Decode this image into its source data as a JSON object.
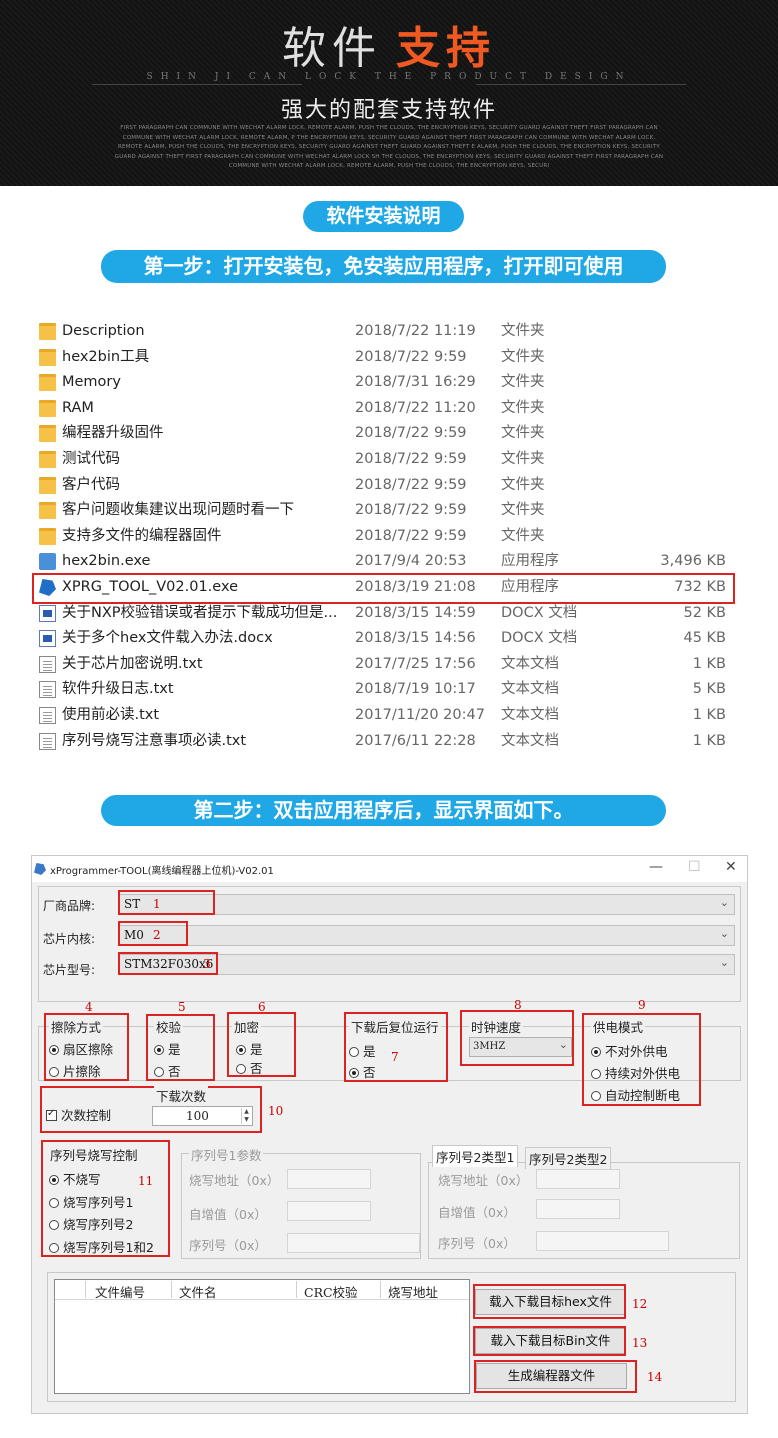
{
  "banner": {
    "title_a": "软件",
    "title_b": "支持",
    "subtitle": "SHIN JI CAN LOCK THE PRODUCT DESIGN",
    "tagline": "强大的配套支持软件",
    "fine_print": "FIRST PARAGRAPH CAN COMMUNE WITH WECHAT ALARM LOCK, REMOTE ALARM, PUSH THE CLOUDS, THE ENCRYPTION KEYS, SECURITY GUARD AGAINST THEFT FIRST PARAGRAPH CAN COMMUNE WITH WECHAT ALARM LOCK, REMOTE ALARM, P THE ENCRYPTION KEYS, SECURITY GUARD AGAINST THEFT FIRST PARAGRAPH CAN COMMUNE WITH WECHAT ALARM LOCK, REMOTE ALARM, PUSH THE CLOUDS, THE ENCRYPTION KEYS, SECURITY GUARD AGAINST THEFT GUARD AGAINST THEFT E ALARM, PUSH THE CLOUDS, THE ENCRYPTION KEYS, SECURITY GUARD AGAINST THEFT FIRST PARAGRAPH CAN COMMUNE WITH WECHAT ALARM LOCK SH THE CLOUDS, THE ENCRYPTION KEYS, SECURITY GUARD AGAINST THEFT FIRST PARAGRAPH CAN COMMUNE WITH WECHAT ALARM LOCK, REMOTE ALARM, PUSH THE CLOUDS, THE ENCRYPTION KEYS, SECURI"
  },
  "pills": {
    "install": "软件安装说明",
    "step1": "第一步：打开安装包，免安装应用程序，打开即可使用",
    "step2": "第二步：双击应用程序后，显示界面如下。"
  },
  "files": [
    {
      "name": "Description",
      "date": "2018/7/22 11:19",
      "type": "文件夹",
      "size": "",
      "icon": "folder"
    },
    {
      "name": "hex2bin工具",
      "date": "2018/7/22 9:59",
      "type": "文件夹",
      "size": "",
      "icon": "folder"
    },
    {
      "name": "Memory",
      "date": "2018/7/31 16:29",
      "type": "文件夹",
      "size": "",
      "icon": "folder"
    },
    {
      "name": "RAM",
      "date": "2018/7/22 11:20",
      "type": "文件夹",
      "size": "",
      "icon": "folder"
    },
    {
      "name": "编程器升级固件",
      "date": "2018/7/22 9:59",
      "type": "文件夹",
      "size": "",
      "icon": "folder"
    },
    {
      "name": "测试代码",
      "date": "2018/7/22 9:59",
      "type": "文件夹",
      "size": "",
      "icon": "folder"
    },
    {
      "name": "客户代码",
      "date": "2018/7/22 9:59",
      "type": "文件夹",
      "size": "",
      "icon": "folder"
    },
    {
      "name": "客户问题收集建议出现问题时看一下",
      "date": "2018/7/22 9:59",
      "type": "文件夹",
      "size": "",
      "icon": "folder"
    },
    {
      "name": "支持多文件的编程器固件",
      "date": "2018/7/22 9:59",
      "type": "文件夹",
      "size": "",
      "icon": "folder"
    },
    {
      "name": "hex2bin.exe",
      "date": "2017/9/4 20:53",
      "type": "应用程序",
      "size": "3,496 KB",
      "icon": "exe"
    },
    {
      "name": "XPRG_TOOL_V02.01.exe",
      "date": "2018/3/19 21:08",
      "type": "应用程序",
      "size": "732 KB",
      "icon": "exe2"
    },
    {
      "name": "关于NXP校验错误或者提示下载成功但是...",
      "date": "2018/3/15 14:59",
      "type": "DOCX 文档",
      "size": "52 KB",
      "icon": "doc"
    },
    {
      "name": "关于多个hex文件载入办法.docx",
      "date": "2018/3/15 14:56",
      "type": "DOCX 文档",
      "size": "45 KB",
      "icon": "doc"
    },
    {
      "name": "关于芯片加密说明.txt",
      "date": "2017/7/25 17:56",
      "type": "文本文档",
      "size": "1 KB",
      "icon": "txt"
    },
    {
      "name": "软件升级日志.txt",
      "date": "2018/7/19 10:17",
      "type": "文本文档",
      "size": "5 KB",
      "icon": "txt"
    },
    {
      "name": "使用前必读.txt",
      "date": "2017/11/20 20:47",
      "type": "文本文档",
      "size": "1 KB",
      "icon": "txt"
    },
    {
      "name": "序列号烧写注意事项必读.txt",
      "date": "2017/6/11 22:28",
      "type": "文本文档",
      "size": "1 KB",
      "icon": "txt"
    }
  ],
  "app": {
    "title": "xProgrammer-TOOL(离线编程器上位机)-V02.01",
    "btn_min": "—",
    "btn_max": "☐",
    "btn_close": "✕",
    "vendor_label": "厂商品牌:",
    "vendor_value": "ST",
    "core_label": "芯片内核:",
    "core_value": "M0",
    "model_label": "芯片型号:",
    "model_value": "STM32F030x6",
    "erase": {
      "title": "擦除方式",
      "opt1": "扇区擦除",
      "opt2": "片擦除"
    },
    "verify": {
      "title": "校验",
      "opt1": "是",
      "opt2": "否"
    },
    "encrypt": {
      "title": "加密",
      "opt1": "是",
      "opt2": "否"
    },
    "reset": {
      "title": "下载后复位运行",
      "opt1": "是",
      "opt2": "否"
    },
    "clock": {
      "title": "时钟速度",
      "value": "3MHZ"
    },
    "power": {
      "title": "供电模式",
      "opt1": "不对外供电",
      "opt2": "持续对外供电",
      "opt3": "自动控制断电"
    },
    "count": {
      "title": "下载次数",
      "check_label": "次数控制",
      "value": "100"
    },
    "serial": {
      "title": "序列号烧写控制",
      "opt1": "不烧写",
      "opt2": "烧写序列号1",
      "opt3": "烧写序列号2",
      "opt4": "烧写序列号1和2"
    },
    "serial1": {
      "title": "序列号1参数",
      "addr": "烧写地址（0x）",
      "inc": "自增值（0x）",
      "sn": "序列号（0x）"
    },
    "serial2": {
      "tab1": "序列号2类型1",
      "tab2": "序列号2类型2",
      "addr": "烧写地址（0x）",
      "inc": "自增值（0x）",
      "sn": "序列号（0x）"
    },
    "table_headers": [
      "文件编号",
      "文件名",
      "CRC校验",
      "烧写地址"
    ],
    "buttons": {
      "load_hex": "载入下载目标hex文件",
      "load_bin": "载入下载目标Bin文件",
      "generate": "生成编程器文件"
    },
    "markers": [
      "1",
      "2",
      "3",
      "4",
      "5",
      "6",
      "7",
      "8",
      "9",
      "10",
      "11",
      "12",
      "13",
      "14"
    ]
  },
  "colors": {
    "accent_blue": "#1fa7e6",
    "highlight_red": "#d22222",
    "banner_orange": "#f05a22"
  }
}
